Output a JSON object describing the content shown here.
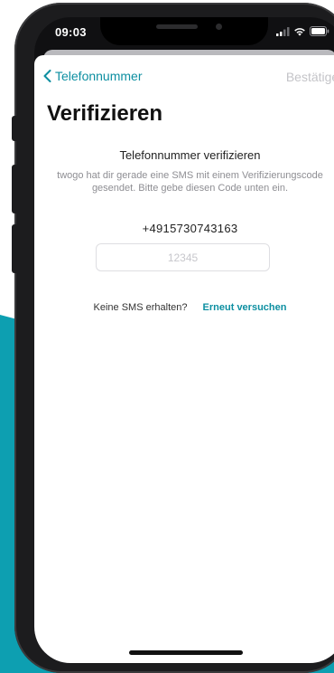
{
  "status_bar": {
    "time": "09:03"
  },
  "nav": {
    "back_label": "Telefonnummer",
    "confirm_label": "Bestätigen"
  },
  "page": {
    "title": "Verifizieren",
    "section_title": "Telefonnummer verifizieren",
    "description": "twogo hat dir gerade eine SMS mit einem Verifizierungscode gesendet. Bitte gebe diesen Code unten ein.",
    "phone_number": "+4915730743163"
  },
  "code_input": {
    "value": "",
    "placeholder": "12345"
  },
  "resend": {
    "label": "Keine SMS erhalten?",
    "link": "Erneut versuchen"
  },
  "colors": {
    "accent": "#0d8fa1",
    "backdrop": "#0d9fb1",
    "disabled": "#c4c4c8"
  }
}
